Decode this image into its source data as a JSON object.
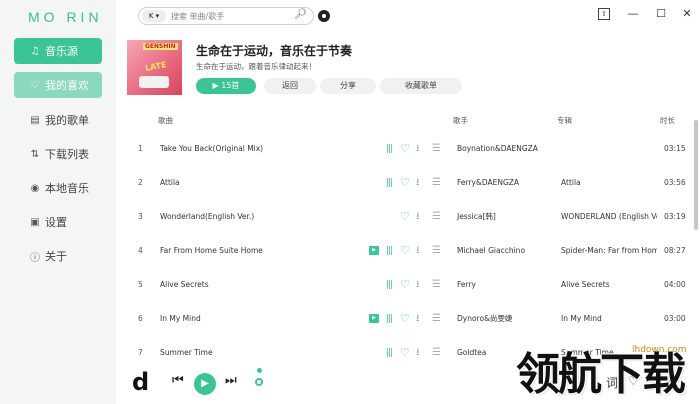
{
  "app": {
    "logo": "MO RIN"
  },
  "sidebar": {
    "items": [
      {
        "label": "音乐源",
        "icon": "music-source-icon",
        "glyph": "♫"
      },
      {
        "label": "我的喜欢",
        "icon": "heart-icon",
        "glyph": "♡"
      },
      {
        "label": "我的歌单",
        "icon": "playlist-icon",
        "glyph": "▤"
      },
      {
        "label": "下载列表",
        "icon": "download-sort-icon",
        "glyph": "⇅"
      },
      {
        "label": "本地音乐",
        "icon": "local-music-icon",
        "glyph": "◉"
      },
      {
        "label": "设置",
        "icon": "settings-icon",
        "glyph": "▣"
      },
      {
        "label": "关于",
        "icon": "about-icon",
        "glyph": "ⓘ"
      }
    ]
  },
  "search": {
    "source": "K ▾",
    "placeholder": "搜索 单曲/歌手"
  },
  "window": {
    "mini": "⇧",
    "minimize": "—",
    "maximize": "☐",
    "close": "✕"
  },
  "playlist": {
    "cover_label": "GENSHIN",
    "cover_text": "LATE",
    "title": "生命在于运动，音乐在于节奏",
    "subtitle": "生命在于运动，跟着音乐律动起来！",
    "play_label": "15首",
    "back_label": "返回",
    "share_label": "分享",
    "fav_label": "收藏歌单"
  },
  "table": {
    "headers": {
      "title": "歌曲",
      "artist": "歌手",
      "album": "专辑",
      "time": "时长"
    },
    "rows": [
      {
        "num": "1",
        "title": "Take You Back(Original Mix)",
        "artist": "Boynation&DAENGZA",
        "album": "",
        "time": "03:15",
        "mv": false,
        "wave": true
      },
      {
        "num": "2",
        "title": "Attila",
        "artist": "Ferry&DAENGZA",
        "album": "Attila",
        "time": "03:56",
        "mv": false,
        "wave": true
      },
      {
        "num": "3",
        "title": "Wonderland(English Ver.)",
        "artist": "Jessica[韩]",
        "album": "WONDERLAND (English Ve",
        "time": "03:19",
        "mv": false,
        "wave": false
      },
      {
        "num": "4",
        "title": "Far From Home Suite Home",
        "artist": "Michael Giacchino",
        "album": "Spider-Man: Far from Hom",
        "time": "08:27",
        "mv": true,
        "wave": true
      },
      {
        "num": "5",
        "title": "Alive Secrets",
        "artist": "Ferry",
        "album": "Alive Secrets",
        "time": "04:00",
        "mv": false,
        "wave": true
      },
      {
        "num": "6",
        "title": "In My Mind",
        "artist": "Dynoro&尚雯婕",
        "album": "In My Mind",
        "time": "03:00",
        "mv": true,
        "wave": true
      },
      {
        "num": "7",
        "title": "Summer Time",
        "artist": "Goldtea",
        "album": "Summer Time",
        "time": "",
        "mv": false,
        "wave": true
      }
    ]
  },
  "player": {
    "logo": "d",
    "prev": "⏮",
    "play": "▶",
    "next": "⏭",
    "controls": [
      "词",
      "♡",
      "下载"
    ]
  },
  "watermark": {
    "text": "领航下载",
    "site": "lhdown.com"
  }
}
